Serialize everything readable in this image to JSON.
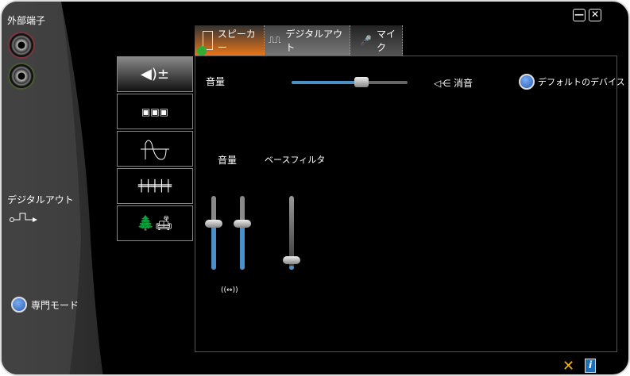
{
  "window": {
    "minimize_label": "—",
    "close_label": "✕"
  },
  "left": {
    "jacks_title": "外部端子",
    "digital_out_label": "デジタルアウト",
    "expert_mode_label": "専門モード"
  },
  "tabs": [
    {
      "label": "スピーカー",
      "active": true
    },
    {
      "label": "デジタルアウト"
    },
    {
      "label": "マイク"
    }
  ],
  "side_buttons": [
    "volume-icon",
    "speaker-config-icon",
    "waveform-icon",
    "equalizer-icon",
    "environment-icon"
  ],
  "main": {
    "volume_label": "音量",
    "volume_value": 0.6,
    "mute_label": "消音",
    "default_device_label": "デフォルトのデバイス",
    "channel_volume_label": "音量",
    "bass_filter_label": "ベースフィルタ",
    "left_level": 0.63,
    "right_level": 0.63,
    "bass_level": 0.05,
    "link_label": "((↔))"
  },
  "colors": {
    "accent": "#e8751a",
    "fill": "#4a90c8"
  }
}
